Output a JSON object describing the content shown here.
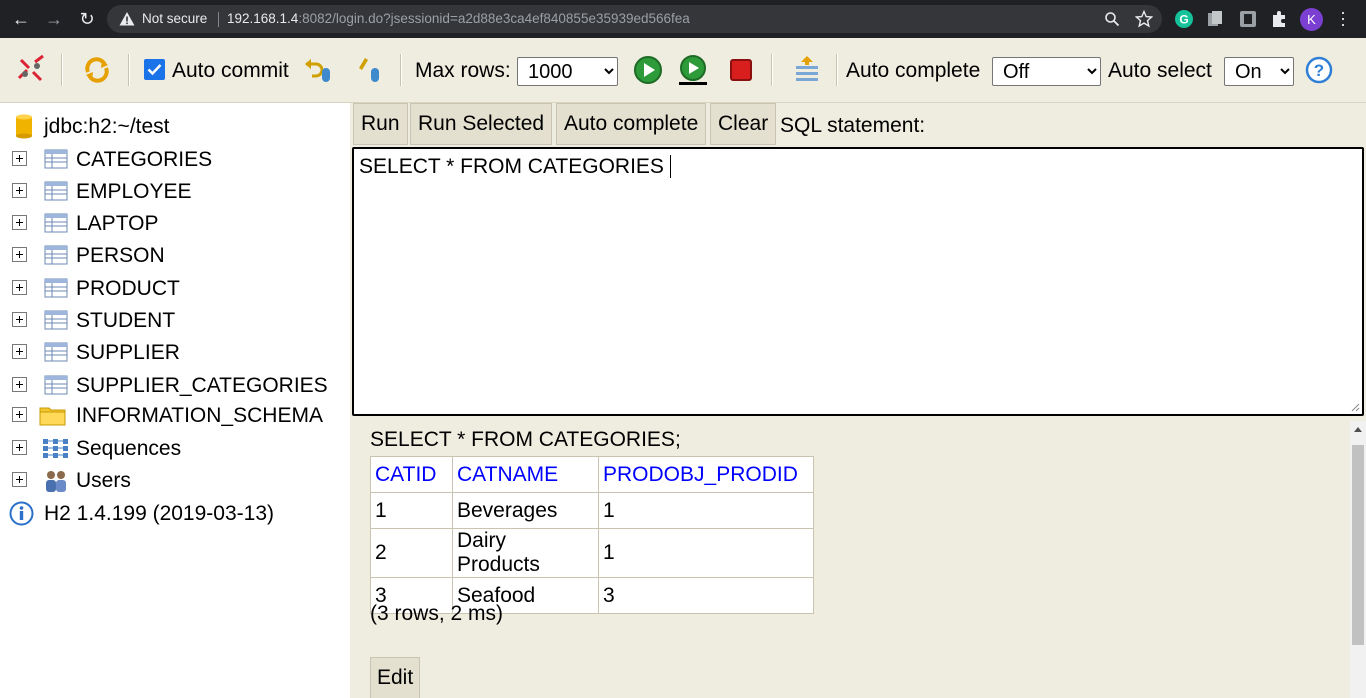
{
  "browser": {
    "not_secure": "Not secure",
    "url_host": "192.168.1.4",
    "url_rest": ":8082/login.do?jsessionid=a2d88e3ca4ef840855e35939ed566fea",
    "profile_initial": "K",
    "colors": {
      "chrome_bg": "#202124",
      "omnibox_bg": "#35363a",
      "profile": "#7b3fd1"
    }
  },
  "toolbar": {
    "auto_commit_label": "Auto commit",
    "auto_commit_checked": true,
    "max_rows_label": "Max rows:",
    "max_rows_value": "1000",
    "auto_complete_label": "Auto complete",
    "auto_complete_value": "Off",
    "auto_select_label": "Auto select",
    "auto_select_value": "On",
    "icons": [
      "disconnect-icon",
      "refresh-icon",
      "rollback-icon",
      "commit-icon",
      "run-icon",
      "run-selected-icon",
      "stop-icon",
      "history-icon",
      "help-icon"
    ]
  },
  "tree": {
    "connection": "jdbc:h2:~/test",
    "tables": [
      "CATEGORIES",
      "EMPLOYEE",
      "LAPTOP",
      "PERSON",
      "PRODUCT",
      "STUDENT",
      "SUPPLIER",
      "SUPPLIER_CATEGORIES"
    ],
    "schema": "INFORMATION_SCHEMA",
    "sequences": "Sequences",
    "users": "Users",
    "version": "H2 1.4.199 (2019-03-13)"
  },
  "editor": {
    "buttons": {
      "run": "Run",
      "run_selected": "Run Selected",
      "auto_complete": "Auto complete",
      "clear": "Clear"
    },
    "sql_label": "SQL statement:",
    "sql_text": "SELECT * FROM CATEGORIES "
  },
  "result": {
    "statement": "SELECT * FROM CATEGORIES;",
    "columns": [
      "CATID",
      "CATNAME",
      "PRODOBJ_PRODID"
    ],
    "rows": [
      [
        "1",
        "Beverages",
        "1"
      ],
      [
        "2",
        "Dairy Products",
        "1"
      ],
      [
        "3",
        "Seafood",
        "3"
      ]
    ],
    "info": "(3 rows, 2 ms)",
    "edit_label": "Edit"
  }
}
